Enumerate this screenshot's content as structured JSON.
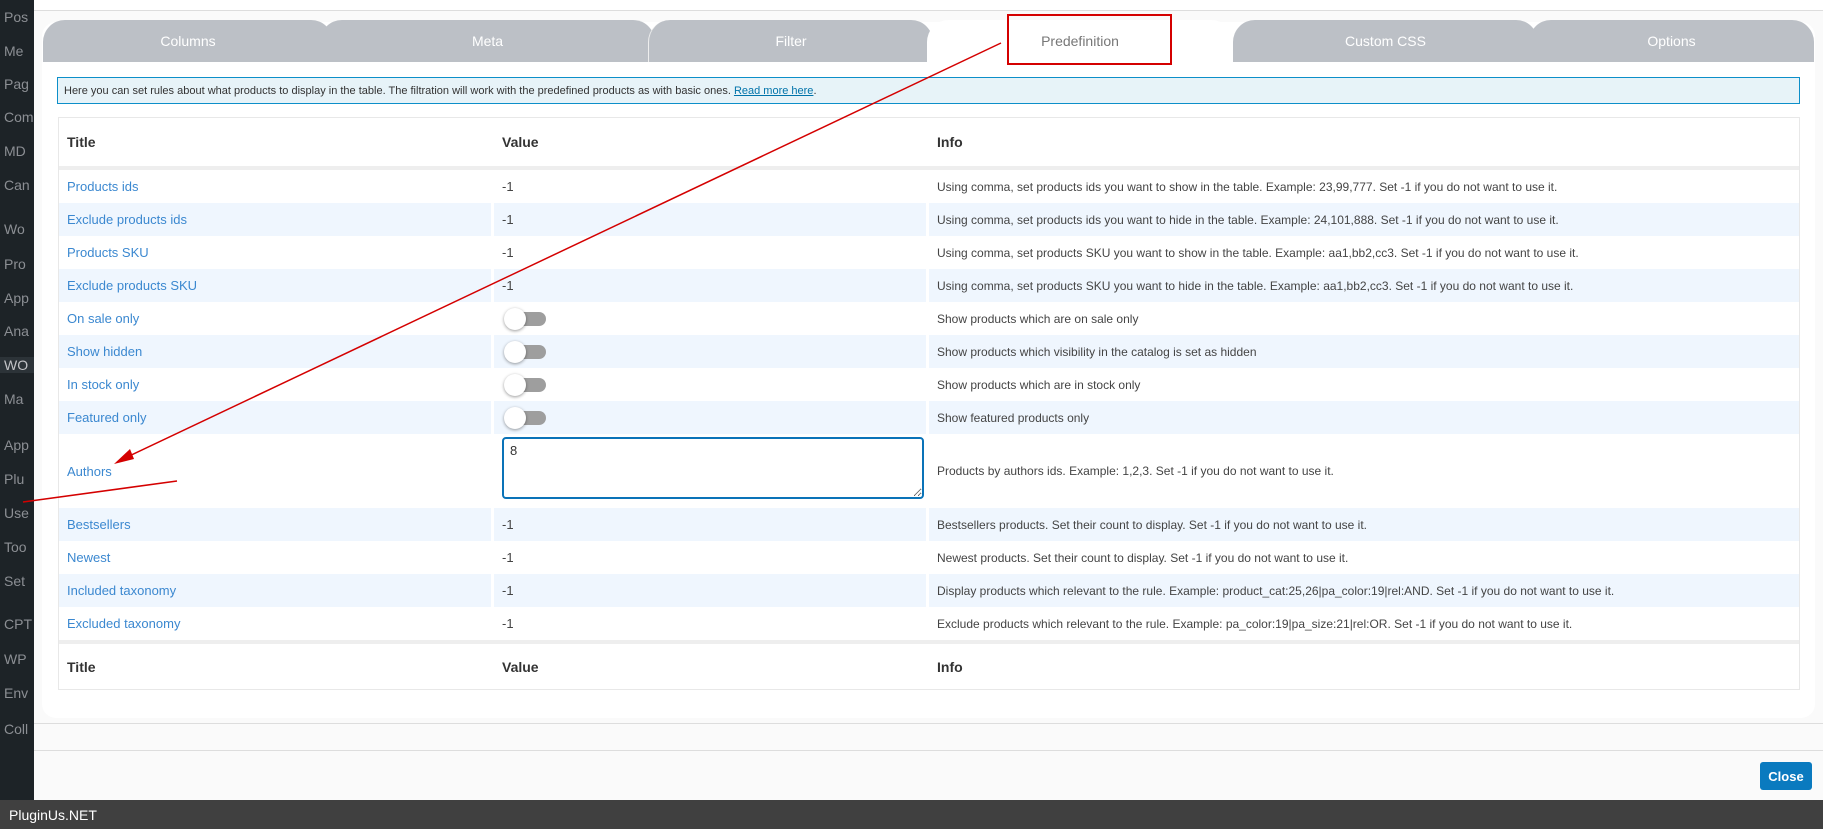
{
  "sidebar": {
    "items": [
      "Pos",
      "Me",
      "Pag",
      "Com",
      "MD",
      "Can",
      "Wo",
      "Pro",
      "App",
      "Ana",
      "WO",
      "Ma",
      "App",
      "Plu",
      "Use",
      "Too",
      "Set",
      "CPT",
      "WP",
      "Env",
      "Coll"
    ]
  },
  "tabs": [
    {
      "label": "Columns"
    },
    {
      "label": "Meta"
    },
    {
      "label": "Filter"
    },
    {
      "label": "Predefinition"
    },
    {
      "label": "Custom CSS"
    },
    {
      "label": "Options"
    }
  ],
  "notice": {
    "text": "Here you can set rules about what products to display in the table. The filtration will work with the predefined products as with basic ones. ",
    "link": "Read more here",
    "end": "."
  },
  "table": {
    "headers": {
      "title": "Title",
      "value": "Value",
      "info": "Info"
    },
    "rows": [
      {
        "title": "Products ids",
        "value": "-1",
        "info": "Using comma, set products ids you want to show in the table. Example: 23,99,777. Set -1 if you do not want to use it."
      },
      {
        "title": "Exclude products ids",
        "value": "-1",
        "info": "Using comma, set products ids you want to hide in the table. Example: 24,101,888. Set -1 if you do not want to use it."
      },
      {
        "title": "Products SKU",
        "value": "-1",
        "info": "Using comma, set products SKU you want to show in the table. Example: aa1,bb2,cc3. Set -1 if you do not want to use it."
      },
      {
        "title": "Exclude products SKU",
        "value": "-1",
        "info": "Using comma, set products SKU you want to hide in the table. Example: aa1,bb2,cc3. Set -1 if you do not want to use it."
      },
      {
        "title": "On sale only",
        "toggle": false,
        "info": "Show products which are on sale only"
      },
      {
        "title": "Show hidden",
        "toggle": false,
        "info": "Show products which visibility in the catalog is set as hidden"
      },
      {
        "title": "In stock only",
        "toggle": false,
        "info": "Show products which are in stock only"
      },
      {
        "title": "Featured only",
        "toggle": false,
        "info": "Show featured products only"
      },
      {
        "title": "Authors",
        "value": "8",
        "info": "Products by authors ids. Example: 1,2,3. Set -1 if you do not want to use it."
      },
      {
        "title": "Bestsellers",
        "value": "-1",
        "info": "Bestsellers products. Set their count to display. Set -1 if you do not want to use it."
      },
      {
        "title": "Newest",
        "value": "-1",
        "info": "Newest products. Set their count to display. Set -1 if you do not want to use it."
      },
      {
        "title": "Included taxonomy",
        "value": "-1",
        "info": "Display products which relevant to the rule. Example: product_cat:25,26|pa_color:19|rel:AND. Set -1 if you do not want to use it."
      },
      {
        "title": "Excluded taxonomy",
        "value": "-1",
        "info": "Exclude products which relevant to the rule. Example: pa_color:19|pa_size:21|rel:OR. Set -1 if you do not want to use it."
      }
    ]
  },
  "close_label": "Close",
  "footer": "PluginUs.NET",
  "colors": {
    "accent": "#0a7abf",
    "annotation": "#d40000",
    "tab": "#bcc0c6"
  }
}
